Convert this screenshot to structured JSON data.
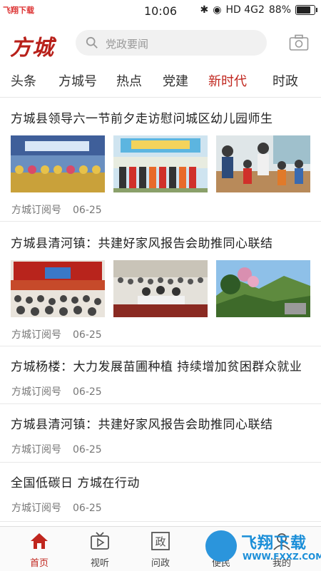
{
  "status_bar": {
    "watermark_left": "飞翔下载",
    "carrier": "◀ ▶ ▢",
    "time": "10:06",
    "network": "HD 4G2",
    "battery": "88%"
  },
  "header": {
    "logo": "方城",
    "search_placeholder": "党政要闻"
  },
  "tabs": [
    "头条",
    "方城号",
    "热点",
    "党建",
    "新时代",
    "时政"
  ],
  "active_tab": 4,
  "news": [
    {
      "title": "方城县领导六一节前夕走访慰问城区幼儿园师生",
      "source": "方城订阅号",
      "date": "06-25"
    },
    {
      "title": "方城县清河镇：共建好家风报告会助推同心联结",
      "source": "方城订阅号",
      "date": "06-25"
    },
    {
      "title": "方城杨楼：大力发展苗圃种植 持续增加贫困群众就业",
      "source": "方城订阅号",
      "date": "06-25"
    },
    {
      "title": "方城县清河镇：共建好家风报告会助推同心联结",
      "source": "方城订阅号",
      "date": "06-25"
    },
    {
      "title": "全国低碳日 方城在行动",
      "source": "方城订阅号",
      "date": "06-25"
    }
  ],
  "bottom_nav": [
    {
      "label": "首页",
      "icon": "home-icon"
    },
    {
      "label": "视听",
      "icon": "tv-icon"
    },
    {
      "label": "问政",
      "icon": "zheng-icon"
    },
    {
      "label": "便民",
      "icon": "people-icon"
    },
    {
      "label": "我的",
      "icon": "user-icon"
    }
  ],
  "watermark": {
    "text": "飞翔下载",
    "url": "WWW.FXXZ.COM"
  },
  "colors": {
    "accent": "#c0261e",
    "logo": "#b8201a"
  }
}
